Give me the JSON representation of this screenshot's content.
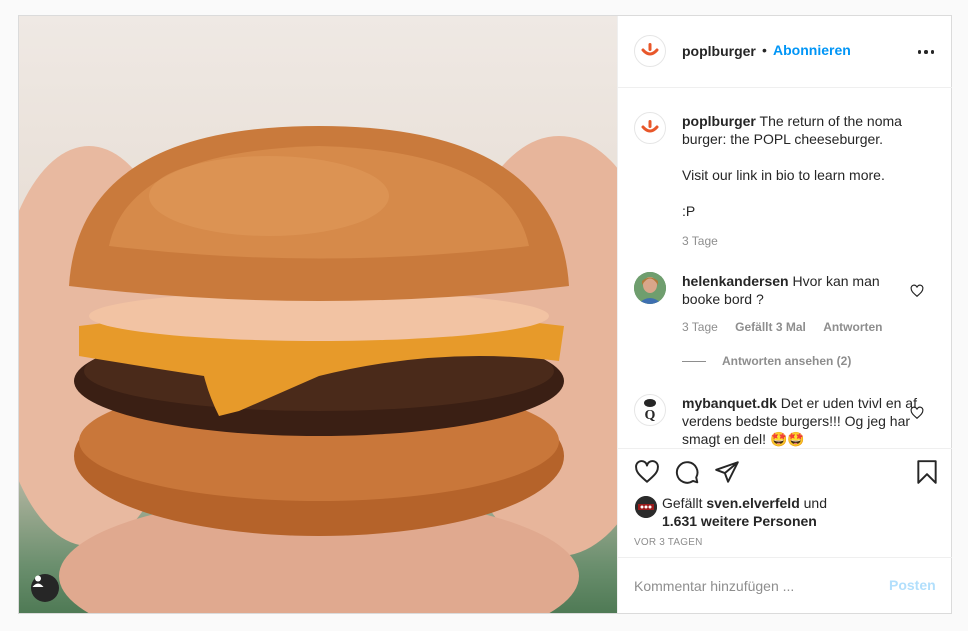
{
  "post": {
    "username": "poplburger",
    "follow_label": "Abonnieren",
    "separator": "•",
    "caption": {
      "username": "poplburger",
      "line1": "The return of the noma burger: the POPL cheeseburger.",
      "line2": "Visit our link in bio to learn more.",
      "line3": ":P",
      "time": "3 Tage"
    }
  },
  "comments": [
    {
      "username": "helenkandersen",
      "text": "Hvor kan man booke bord ?",
      "time": "3 Tage",
      "likes": "Gefällt 3 Mal",
      "reply": "Antworten",
      "view_replies": "Antworten ansehen (2)"
    },
    {
      "username": "mybanquet.dk",
      "text": "Det er uden tvivl en af verdens bedste burgers!!! Og jeg har smagt en del! 🤩🤩"
    }
  ],
  "likes": {
    "prefix": "Gefällt",
    "user": "sven.elverfeld",
    "conj": "und",
    "others": "1.631 weitere Personen"
  },
  "timestamp": "VOR 3 TAGEN",
  "comment_input": {
    "placeholder": "Kommentar hinzufügen ..."
  },
  "post_button": "Posten",
  "colors": {
    "accent": "#0095f6",
    "brand": "#e8572a",
    "muted": "#8e8e8e"
  },
  "icons": [
    "heart-icon",
    "comment-icon",
    "share-icon",
    "bookmark-icon",
    "more-icon",
    "user-tag-icon"
  ]
}
